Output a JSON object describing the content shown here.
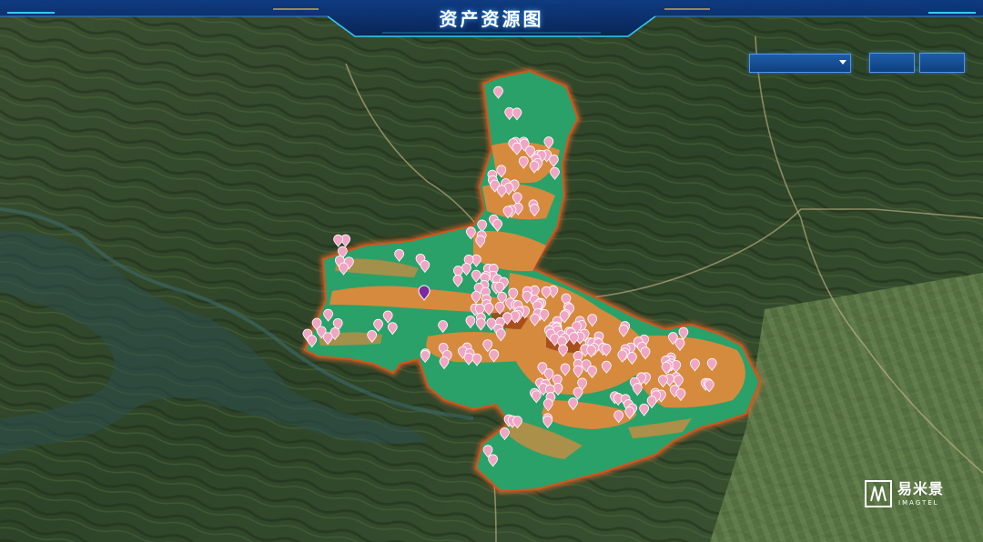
{
  "header": {
    "title": "资产资源图"
  },
  "controls": {
    "dropdown_value": "",
    "button_1_label": "",
    "button_2_label": ""
  },
  "logo": {
    "name_cn": "易米景",
    "name_en": "IMAGTEL"
  },
  "map": {
    "basemap": "satellite-imagery",
    "colors": {
      "region_fill": "#2aa169",
      "region_outline": "#d2541e",
      "parcel_orange": "#e8883a",
      "marker_pink": "#f0a6c3",
      "marker_selected": "#7a2aa0",
      "header_blue": "#0b2f73",
      "accent_cyan": "#35c9ff"
    },
    "marker_count": 190,
    "selected_marker_index": 0
  }
}
